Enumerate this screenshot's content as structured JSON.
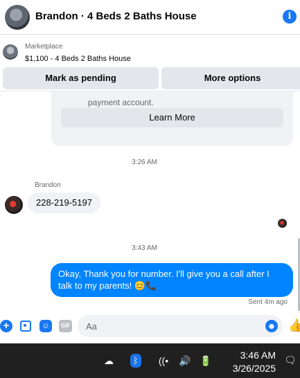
{
  "header": {
    "title": "Brandon · 4 Beds 2 Baths House",
    "info_icon": "info-icon",
    "info_glyph": "i"
  },
  "marketplace": {
    "label": "Marketplace",
    "listing": "$1,100 - 4 Beds 2 Baths House"
  },
  "actions": {
    "mark_pending": "Mark as pending",
    "more_options": "More options"
  },
  "thread": {
    "card": {
      "text": "payment account.",
      "button": "Learn More"
    },
    "timestamp_1": "3:26 AM",
    "incoming": {
      "sender": "Brandon",
      "text": "228-219-5197"
    },
    "timestamp_2": "3:43 AM",
    "outgoing": {
      "text": "Okay, Thank you for number. I'll give you a call after I talk to my parents! 😊📞"
    },
    "sent_status": "Sent 4m ago"
  },
  "composer": {
    "placeholder": "Aa",
    "icons": [
      "plus-icon",
      "photo-icon",
      "sticker-icon",
      "gif-icon",
      "emoji-icon",
      "like-icon"
    ],
    "gif_label": "GIF"
  },
  "taskbar": {
    "time": "3:46 AM",
    "date": "3/26/2025",
    "icons": [
      "onedrive-icon",
      "bluetooth-icon",
      "wifi-icon",
      "volume-icon",
      "battery-icon",
      "notification-icon"
    ]
  },
  "colors": {
    "accent": "#1877f2",
    "outgoing_bubble": "#0084ff",
    "incoming_bubble": "#f0f2f5",
    "taskbar": "#202020"
  }
}
